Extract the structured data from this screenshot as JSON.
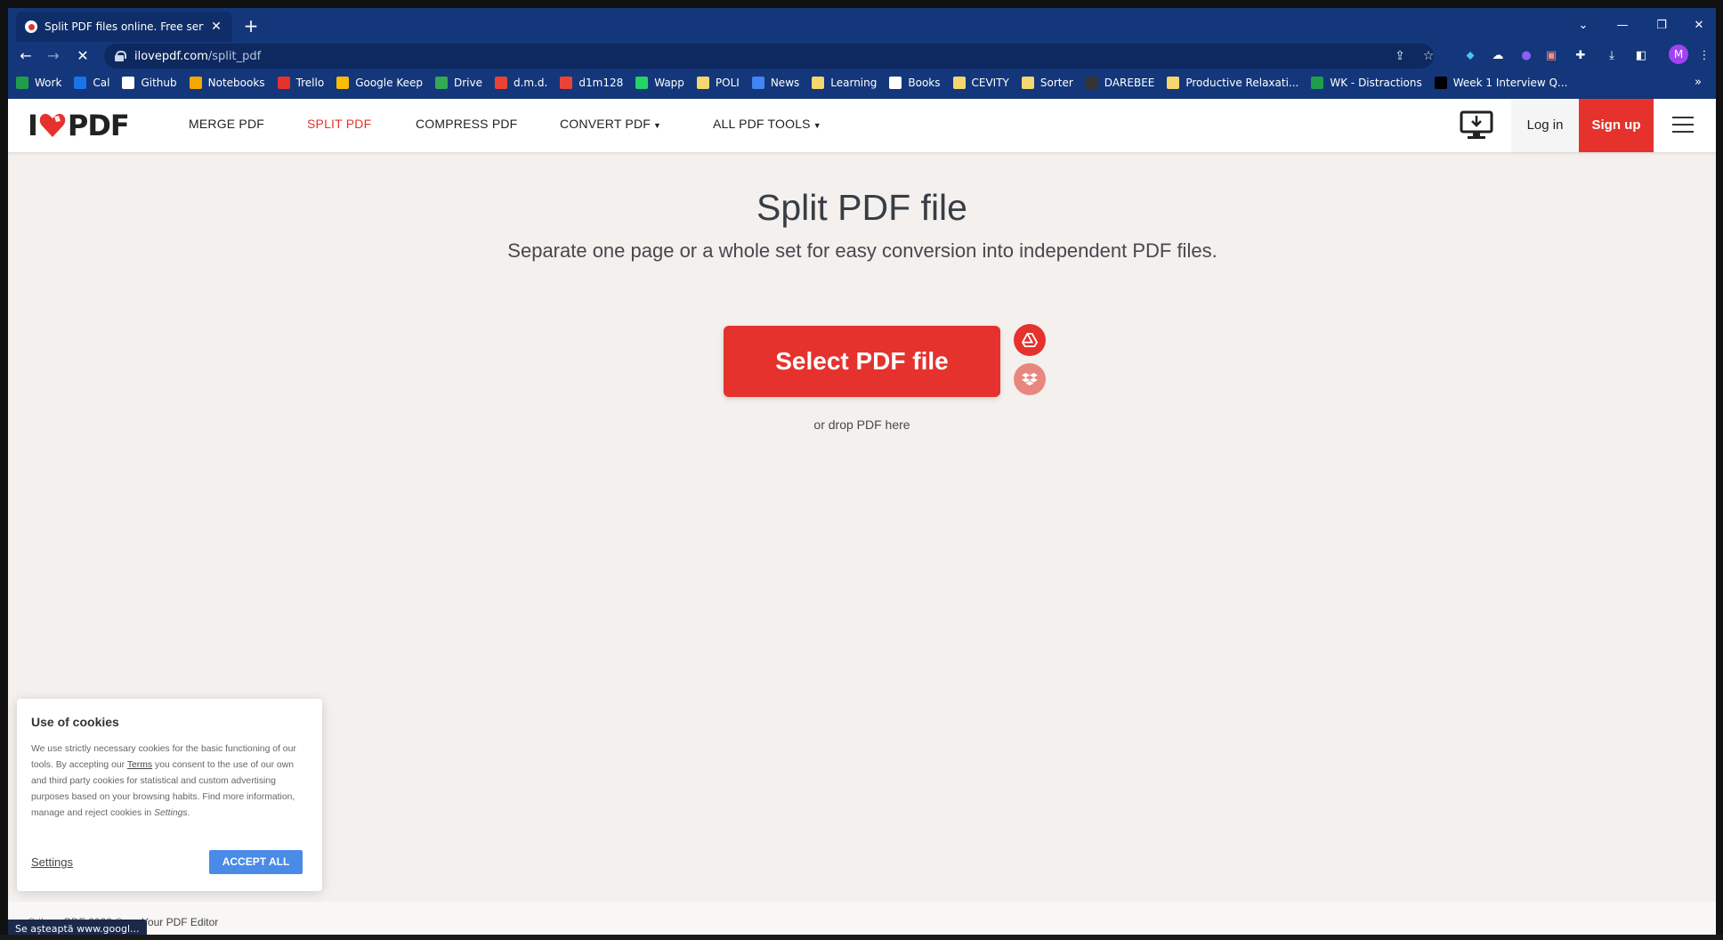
{
  "browser": {
    "tab_title": "Split PDF files online. Free servic",
    "url_host": "ilovepdf.com",
    "url_path": "/split_pdf",
    "window_controls": {
      "tabs_menu": "⌄",
      "minimize": "—",
      "restore": "❐",
      "close": "✕"
    },
    "bookmarks": [
      {
        "label": "Work",
        "color": "#1e9e4a"
      },
      {
        "label": "Cal",
        "color": "#1a73e8"
      },
      {
        "label": "Github",
        "color": "#ffffff"
      },
      {
        "label": "Notebooks",
        "color": "#f4a700"
      },
      {
        "label": "Trello",
        "color": "#e5322d"
      },
      {
        "label": "Google Keep",
        "color": "#fbbc04"
      },
      {
        "label": "Drive",
        "color": "#34a853"
      },
      {
        "label": "d.m.d.",
        "color": "#ea4335"
      },
      {
        "label": "d1m128",
        "color": "#ea4335"
      },
      {
        "label": "Wapp",
        "color": "#25d366"
      },
      {
        "label": "POLI",
        "color": "#f6d66e"
      },
      {
        "label": "News",
        "color": "#4285f4"
      },
      {
        "label": "Learning",
        "color": "#f6d66e"
      },
      {
        "label": "Books",
        "color": "#ffffff"
      },
      {
        "label": "CEVITY",
        "color": "#f6d66e"
      },
      {
        "label": "Sorter",
        "color": "#f6d66e"
      },
      {
        "label": "DAREBEE",
        "color": "#333333"
      },
      {
        "label": "Productive Relaxati...",
        "color": "#f6d66e"
      },
      {
        "label": "WK - Distractions",
        "color": "#1e9e4a"
      },
      {
        "label": "Week 1 Interview Q...",
        "color": "#000000"
      }
    ],
    "profile_initial": "M",
    "status_text": "Se așteaptă www.googl..."
  },
  "site": {
    "logo": {
      "left": "I",
      "right": "PDF"
    },
    "menu": [
      {
        "label": "MERGE PDF",
        "active": false,
        "caret": false
      },
      {
        "label": "SPLIT PDF",
        "active": true,
        "caret": false
      },
      {
        "label": "COMPRESS PDF",
        "active": false,
        "caret": false
      },
      {
        "label": "CONVERT PDF",
        "active": false,
        "caret": true
      },
      {
        "label": "ALL PDF TOOLS",
        "active": false,
        "caret": true
      }
    ],
    "login": "Log in",
    "signup": "Sign up",
    "accent": "#e5322d"
  },
  "hero": {
    "title": "Split PDF file",
    "subtitle": "Separate one page or a whole set for easy conversion into independent PDF files.",
    "select_button": "Select PDF file",
    "drop_hint": "or drop PDF here"
  },
  "cookies": {
    "title": "Use of cookies",
    "text_before": "We use strictly necessary cookies for the basic functioning of our tools. By accepting our ",
    "terms_link": "Terms",
    "text_after": " you consent to the use of our own and third party cookies for statistical and custom advertising purposes based on your browsing habits. Find more information, manage and reject cookies in ",
    "settings_inline": "Settings",
    "text_end": ".",
    "settings_button": "Settings",
    "accept_button": "ACCEPT ALL"
  },
  "footer": {
    "copyright": "© iLovePDF 2022 ®",
    "editor": "Your PDF Editor"
  }
}
